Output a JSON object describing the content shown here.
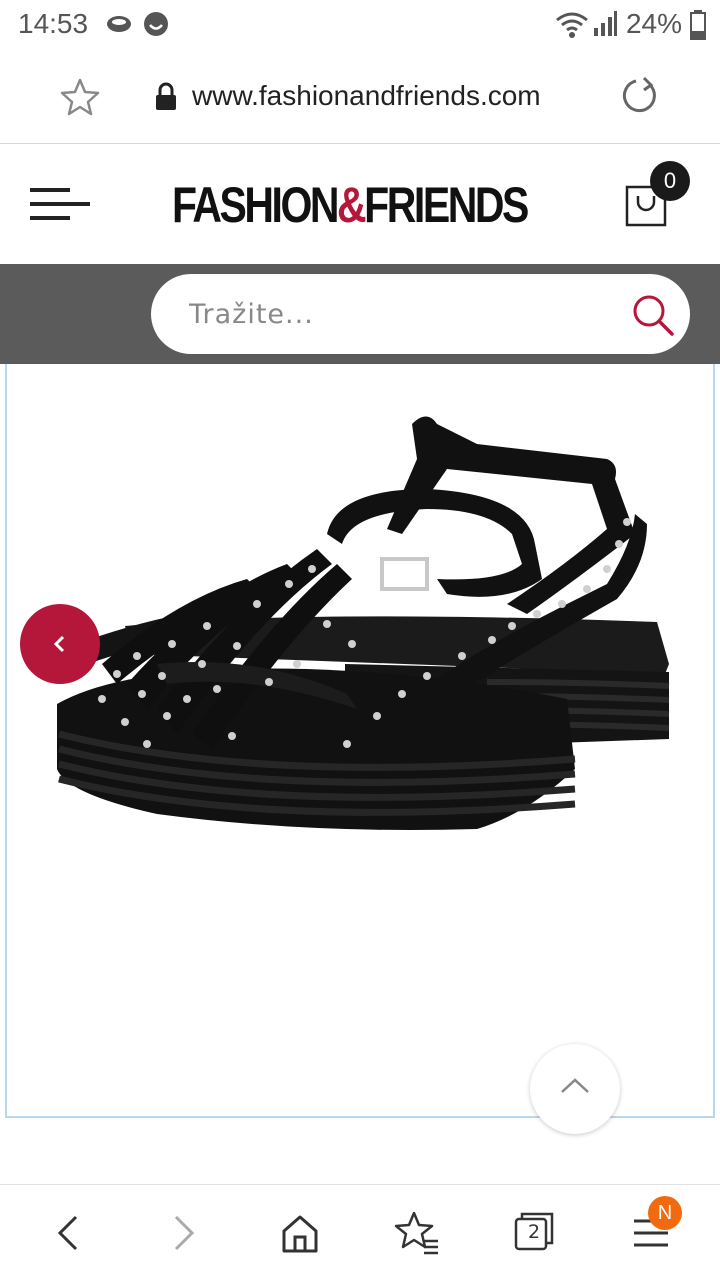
{
  "status_bar": {
    "time": "14:53",
    "battery": "24%",
    "icons": [
      "cloud-icon",
      "smiley-icon",
      "wifi-icon",
      "signal-icon",
      "battery-icon"
    ]
  },
  "browser": {
    "url": "www.fashionandfriends.com",
    "icons": [
      "bookmark-star-icon",
      "lock-icon",
      "reload-icon"
    ]
  },
  "site": {
    "logo_left": "FASHION",
    "logo_amp": "&",
    "logo_right": "FRIENDS",
    "cart_count": "0",
    "search_placeholder": "Tražite..."
  },
  "product": {
    "nav_prev_icon": "chevron-left-icon",
    "scroll_top_icon": "chevron-up-icon"
  },
  "bottom_nav": {
    "tabs_count": "2",
    "menu_badge": "N",
    "items": [
      "back-icon",
      "forward-icon",
      "home-icon",
      "bookmarks-icon",
      "tabs-icon",
      "menu-icon"
    ]
  },
  "colors": {
    "brand_accent": "#b5173b",
    "search_band": "#5b5b5b",
    "new_badge": "#f26a0f"
  }
}
